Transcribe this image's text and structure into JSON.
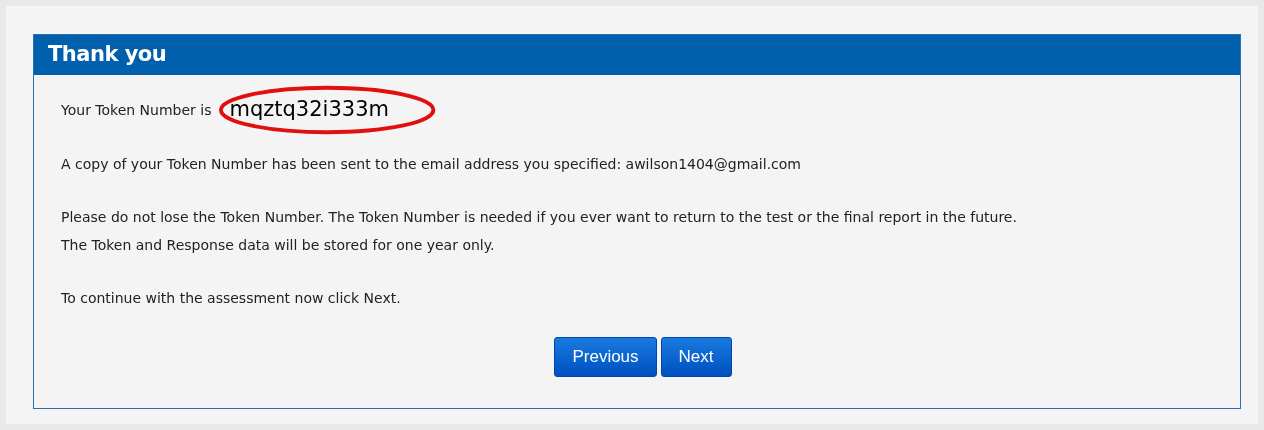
{
  "panel": {
    "title": "Thank you"
  },
  "token": {
    "label": "Your Token Number is",
    "value": "mqztq32i333m"
  },
  "paragraphs": [
    [
      "A copy of your Token Number has been sent to the email address you specified: awilson1404@gmail.com"
    ],
    [
      "Please do not lose the Token Number. The Token Number is needed if you ever want to return to the test or the final report in the future.",
      "The Token and Response data will be stored for one year only."
    ],
    [
      "To continue with the assessment now click Next."
    ]
  ],
  "buttons": [
    "Previous",
    "Next"
  ]
}
